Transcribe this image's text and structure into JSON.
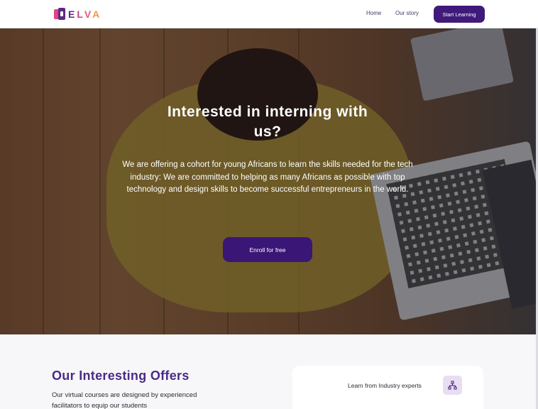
{
  "header": {
    "logo_text": "ELVA",
    "nav": [
      {
        "label": "Home"
      },
      {
        "label": "Our story"
      }
    ],
    "cta_label": "Start Learning"
  },
  "hero": {
    "title": "Interested in interning with us?",
    "description": "We are offering a cohort for young Africans to learn the skills needed for the tech industry: We are committed to helping as many Africans as possible with top technology and design skills to become successful entrepreneurs in the world.",
    "enroll_label": "Enroll for free"
  },
  "offers": {
    "title": "Our Interesting Offers",
    "description": "Our virtual courses are designed by experienced facilitators to equip our students",
    "card": {
      "label": "Learn from Industry experts",
      "icon": "network-icon"
    }
  },
  "colors": {
    "primary": "#3f1a7a",
    "heading": "#4a2a86",
    "icon_bg": "#e9ddf2"
  }
}
